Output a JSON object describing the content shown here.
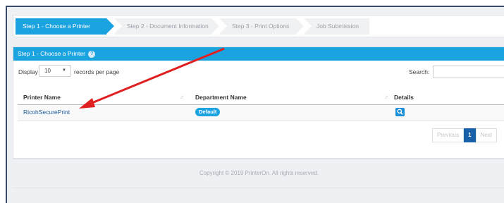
{
  "steps": [
    {
      "label": "Step 1 - Choose a Printer",
      "active": true
    },
    {
      "label": "Step 2 - Document Information",
      "active": false
    },
    {
      "label": "Step 3 - Print Options",
      "active": false
    },
    {
      "label": "Job Submission",
      "active": false
    }
  ],
  "panel": {
    "title": "Step 1 - Choose a Printer",
    "help_icon_text": "?"
  },
  "controls": {
    "display_label": "Display",
    "records_value": "10",
    "per_page_label": "records per page",
    "search_label": "Search:",
    "search_value": ""
  },
  "table": {
    "columns": [
      "Printer Name",
      "Department Name",
      "Details"
    ],
    "rows": [
      {
        "printer": "RicohSecurePrint",
        "department": "Default",
        "details_icon": "search-icon"
      }
    ]
  },
  "pagination": {
    "previous_label": "Previous",
    "current_page": "1",
    "next_label": "Next"
  },
  "footer": {
    "copyright": "Copyright © 2019 PrinterOn. All rights reserved."
  },
  "colors": {
    "accent": "#1ba3e0",
    "annotation_arrow": "#e02020",
    "page_button": "#1860a8"
  }
}
